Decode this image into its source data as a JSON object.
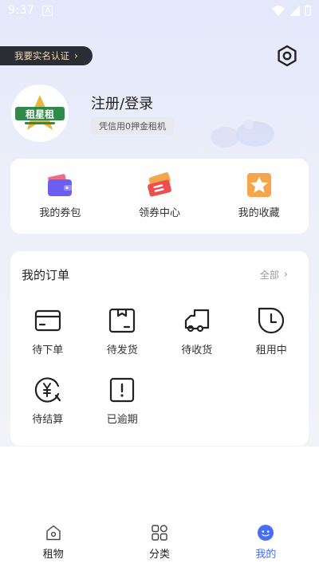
{
  "status_bar": {
    "time": "9:37",
    "notif": "A"
  },
  "profile": {
    "verify_badge": "我要实名认证",
    "login_title": "注册/登录",
    "credit_tag": "凭信用0押金租机",
    "avatar_logo_text": "租星租"
  },
  "quick_actions": [
    {
      "label": "我的券包",
      "icon": "wallet-icon"
    },
    {
      "label": "领券中心",
      "icon": "coupon-icon"
    },
    {
      "label": "我的收藏",
      "icon": "star-icon"
    }
  ],
  "orders": {
    "title": "我的订单",
    "all_label": "全部",
    "items": [
      {
        "label": "待下单",
        "icon": "card-icon"
      },
      {
        "label": "待发货",
        "icon": "box-icon"
      },
      {
        "label": "待收货",
        "icon": "truck-icon"
      },
      {
        "label": "租用中",
        "icon": "clock-icon"
      },
      {
        "label": "待结算",
        "icon": "yuan-icon"
      },
      {
        "label": "已逾期",
        "icon": "alert-icon"
      }
    ]
  },
  "bottom_nav": [
    {
      "label": "租物",
      "icon": "home-icon",
      "active": false
    },
    {
      "label": "分类",
      "icon": "category-icon",
      "active": false
    },
    {
      "label": "我的",
      "icon": "profile-icon",
      "active": true
    }
  ],
  "colors": {
    "accent": "#4a6df5",
    "badge_bg": "#2a2d33",
    "badge_text": "#f3dcae"
  }
}
